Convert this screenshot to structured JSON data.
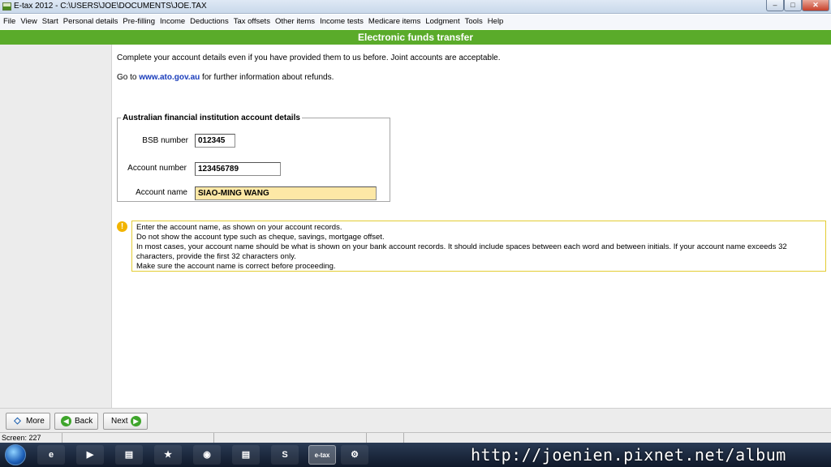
{
  "window": {
    "title": "E-tax 2012 - C:\\USERS\\JOE\\DOCUMENTS\\JOE.TAX",
    "min_glyph": "–",
    "max_glyph": "□",
    "close_glyph": "✕"
  },
  "menu": [
    "File",
    "View",
    "Start",
    "Personal details",
    "Pre-filling",
    "Income",
    "Deductions",
    "Tax offsets",
    "Other items",
    "Income tests",
    "Medicare items",
    "Lodgment",
    "Tools",
    "Help"
  ],
  "page": {
    "heading": "Electronic funds transfer",
    "intro": "Complete your account details even if you have provided them to us before. Joint accounts are acceptable.",
    "goto_prefix": "Go to ",
    "goto_link": "www.ato.gov.au",
    "goto_suffix": " for further information about refunds."
  },
  "account": {
    "legend": "Australian financial institution account details",
    "bsb_label": "BSB number",
    "bsb_value": "012345",
    "account_number_label": "Account number",
    "account_number_value": "123456789",
    "account_name_label": "Account name",
    "account_name_value": "SIAO-MING WANG"
  },
  "hint": {
    "icon": "!",
    "lines": [
      "Enter the account name, as shown on your account records.",
      "Do not show the account type such as cheque, savings, mortgage offset.",
      "In most cases, your account name should be what is shown on your bank account records. It should include spaces between each word and between initials. If your account name exceeds 32",
      "characters, provide the first 32 characters only.",
      "Make sure the account name is correct before proceeding."
    ]
  },
  "nav": {
    "more": "More",
    "back": "Back",
    "next": "Next"
  },
  "status": {
    "screen": "Screen: 227"
  },
  "taskbar": {
    "etax_label": "e-tax",
    "skype_glyph": "S"
  },
  "watermark": "http://joenien.pixnet.net/album"
}
